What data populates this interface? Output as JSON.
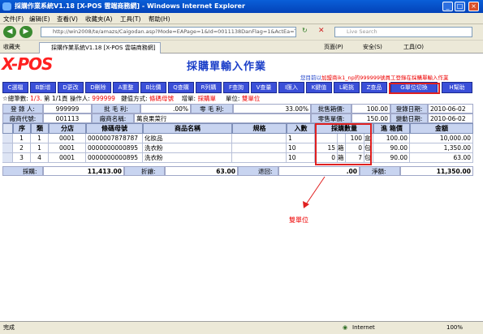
{
  "window": {
    "title": "採購作業系統V1.18 [X-POS 雲端商務網] - Windows Internet Explorer"
  },
  "menu": [
    "文件(F)",
    "编辑(E)",
    "查看(V)",
    "收藏夹(A)",
    "工具(T)",
    "帮助(H)"
  ],
  "address": {
    "url": "http://win2008/te/amazs/Caigodan.asp?Mode=EAPage=1&Id=0011138DanFlag=1&ActEa=True&Act=0"
  },
  "search": {
    "placeholder": "Live Search"
  },
  "favorites": {
    "label": "收藏夹",
    "tab": "採購作業系統V1.18 [X-POS 雲端商務網]",
    "tools": [
      "页面(P)",
      "安全(S)",
      "工具(O)"
    ]
  },
  "app": {
    "logo": "X-POS",
    "title": "採購單輸入作業",
    "notice": {
      "pre": "您目前以",
      "user": "加盟商ik1_np的999999號員工登錄在",
      "post": "採購單輸入作業"
    }
  },
  "toolbar": [
    "C選檔",
    "B新增",
    "D更改",
    "D刪除",
    "A重整",
    "B比價",
    "Q查購",
    "R列購",
    "F查詢",
    "V查量",
    "I匯入",
    "K鍵值",
    "L範挑",
    "Z查品",
    "G單位切換",
    "H幫助"
  ],
  "info": {
    "total_label": "☆總筆數:",
    "total_value": "1/3.",
    "page_label": "第 1/1頁",
    "operator_label": "操作人:",
    "operator_value": "999999",
    "key_label": "鍵值方式:",
    "key_value": "條碼母號",
    "mode_label": "增單:",
    "mode_value": "採購單",
    "unit_label": "單位:",
    "unit_value": "雙單位"
  },
  "form": {
    "row1": {
      "l1": "登 錄 人:",
      "v1": "999999",
      "l2": "批 毛 利:",
      "v2": ".00%",
      "l3": "零 毛 利:",
      "v3": "33.00%",
      "l4": "批售箱價:",
      "v4": "100.00",
      "l5": "登錄日期:",
      "v5": "2010-06-02"
    },
    "row2": {
      "l1": "廠商代號:",
      "v1": "001113",
      "l2": "廠商名稱:",
      "v2": "萬良果菜行",
      "l4": "零售單價:",
      "v4": "150.00",
      "l5": "變動日期:",
      "v5": "2010-06-02"
    }
  },
  "grid": {
    "headers": [
      "序",
      "類",
      "分店",
      "條碼母號",
      "商品名稱",
      "規格",
      "入數",
      "採購數量",
      "進 箱價",
      "金額"
    ],
    "rows": [
      {
        "seq": "1",
        "cls": "1",
        "store": "0001",
        "barcode": "0000007878787",
        "name": "化妝品",
        "spec": "",
        "qty_in": "1",
        "q1": "",
        "u1": "",
        "q2": "100",
        "u2": "盒",
        "price": "100.00",
        "amount": "10,000.00"
      },
      {
        "seq": "2",
        "cls": "1",
        "store": "0001",
        "barcode": "0000000000895",
        "name": "洗衣粉",
        "spec": "",
        "qty_in": "10",
        "q1": "15",
        "u1": "箱",
        "q2": "0",
        "u2": "包",
        "price": "90.00",
        "amount": "1,350.00"
      },
      {
        "seq": "3",
        "cls": "4",
        "store": "0001",
        "barcode": "0000000000895",
        "name": "洗衣粉",
        "spec": "",
        "qty_in": "10",
        "q1": "0",
        "u1": "箱",
        "q2": "7",
        "u2": "包",
        "price": "90.00",
        "amount": "63.00"
      }
    ]
  },
  "totals": {
    "l1": "採購:",
    "v1": "11,413.00",
    "l2": "折讓:",
    "v2": "63.00",
    "l3": "退回:",
    "v3": ".00",
    "l4": "淨額:",
    "v4": "11,350.00"
  },
  "annotation": "雙單位",
  "status": {
    "left": "完成",
    "zone": "Internet",
    "zoom": "100%"
  }
}
